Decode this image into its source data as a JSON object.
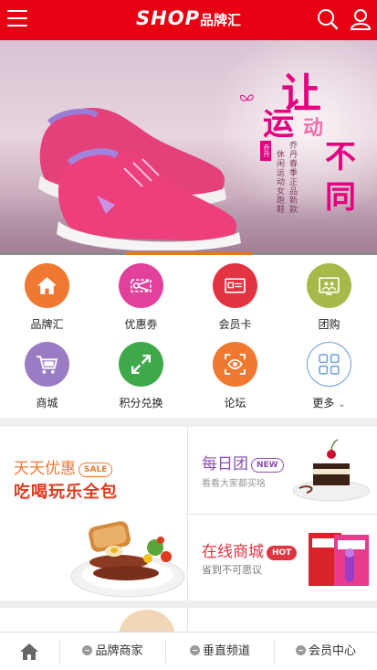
{
  "header": {
    "logo_en": "SHOP",
    "logo_cn": "品牌汇",
    "bg_color": "#e60012"
  },
  "banner": {
    "slogan_chars": [
      "让",
      "运",
      "动",
      "不",
      "同"
    ],
    "vertical_text_1": "乔丹春季正品新款",
    "vertical_text_2": "休闲运动女跑鞋",
    "stamp": "乔丹",
    "active_slide": 2,
    "total_slides": 3
  },
  "grid": {
    "items": [
      {
        "label": "品牌汇",
        "icon": "home-icon",
        "color": "#f07830"
      },
      {
        "label": "优惠劵",
        "icon": "scissors-coupon-icon",
        "color": "#e2409a"
      },
      {
        "label": "会员卡",
        "icon": "card-icon",
        "color": "#e23440"
      },
      {
        "label": "团购",
        "icon": "group-screen-icon",
        "color": "#a6b94a"
      },
      {
        "label": "商城",
        "icon": "cart-icon",
        "color": "#9b7cc4"
      },
      {
        "label": "积分兑换",
        "icon": "exchange-arrows-icon",
        "color": "#3fa94a"
      },
      {
        "label": "论坛",
        "icon": "eye-scan-icon",
        "color": "#f07830"
      },
      {
        "label": "更多",
        "icon": "grid-more-icon",
        "color": "#5a8fd8"
      }
    ],
    "more_chevron": "⌄"
  },
  "promo": {
    "daily_title": "天天优惠",
    "daily_tag": "SALE",
    "daily_slogan": "吃喝玩乐全包",
    "group_title": "每日团",
    "group_tag": "NEW",
    "group_sub": "看看大家都买啥",
    "mall_title": "在线商城",
    "mall_tag": "HOT",
    "mall_sub": "省到不可思议"
  },
  "footer": {
    "items": [
      "品牌商家",
      "垂直频道",
      "会员中心"
    ]
  }
}
